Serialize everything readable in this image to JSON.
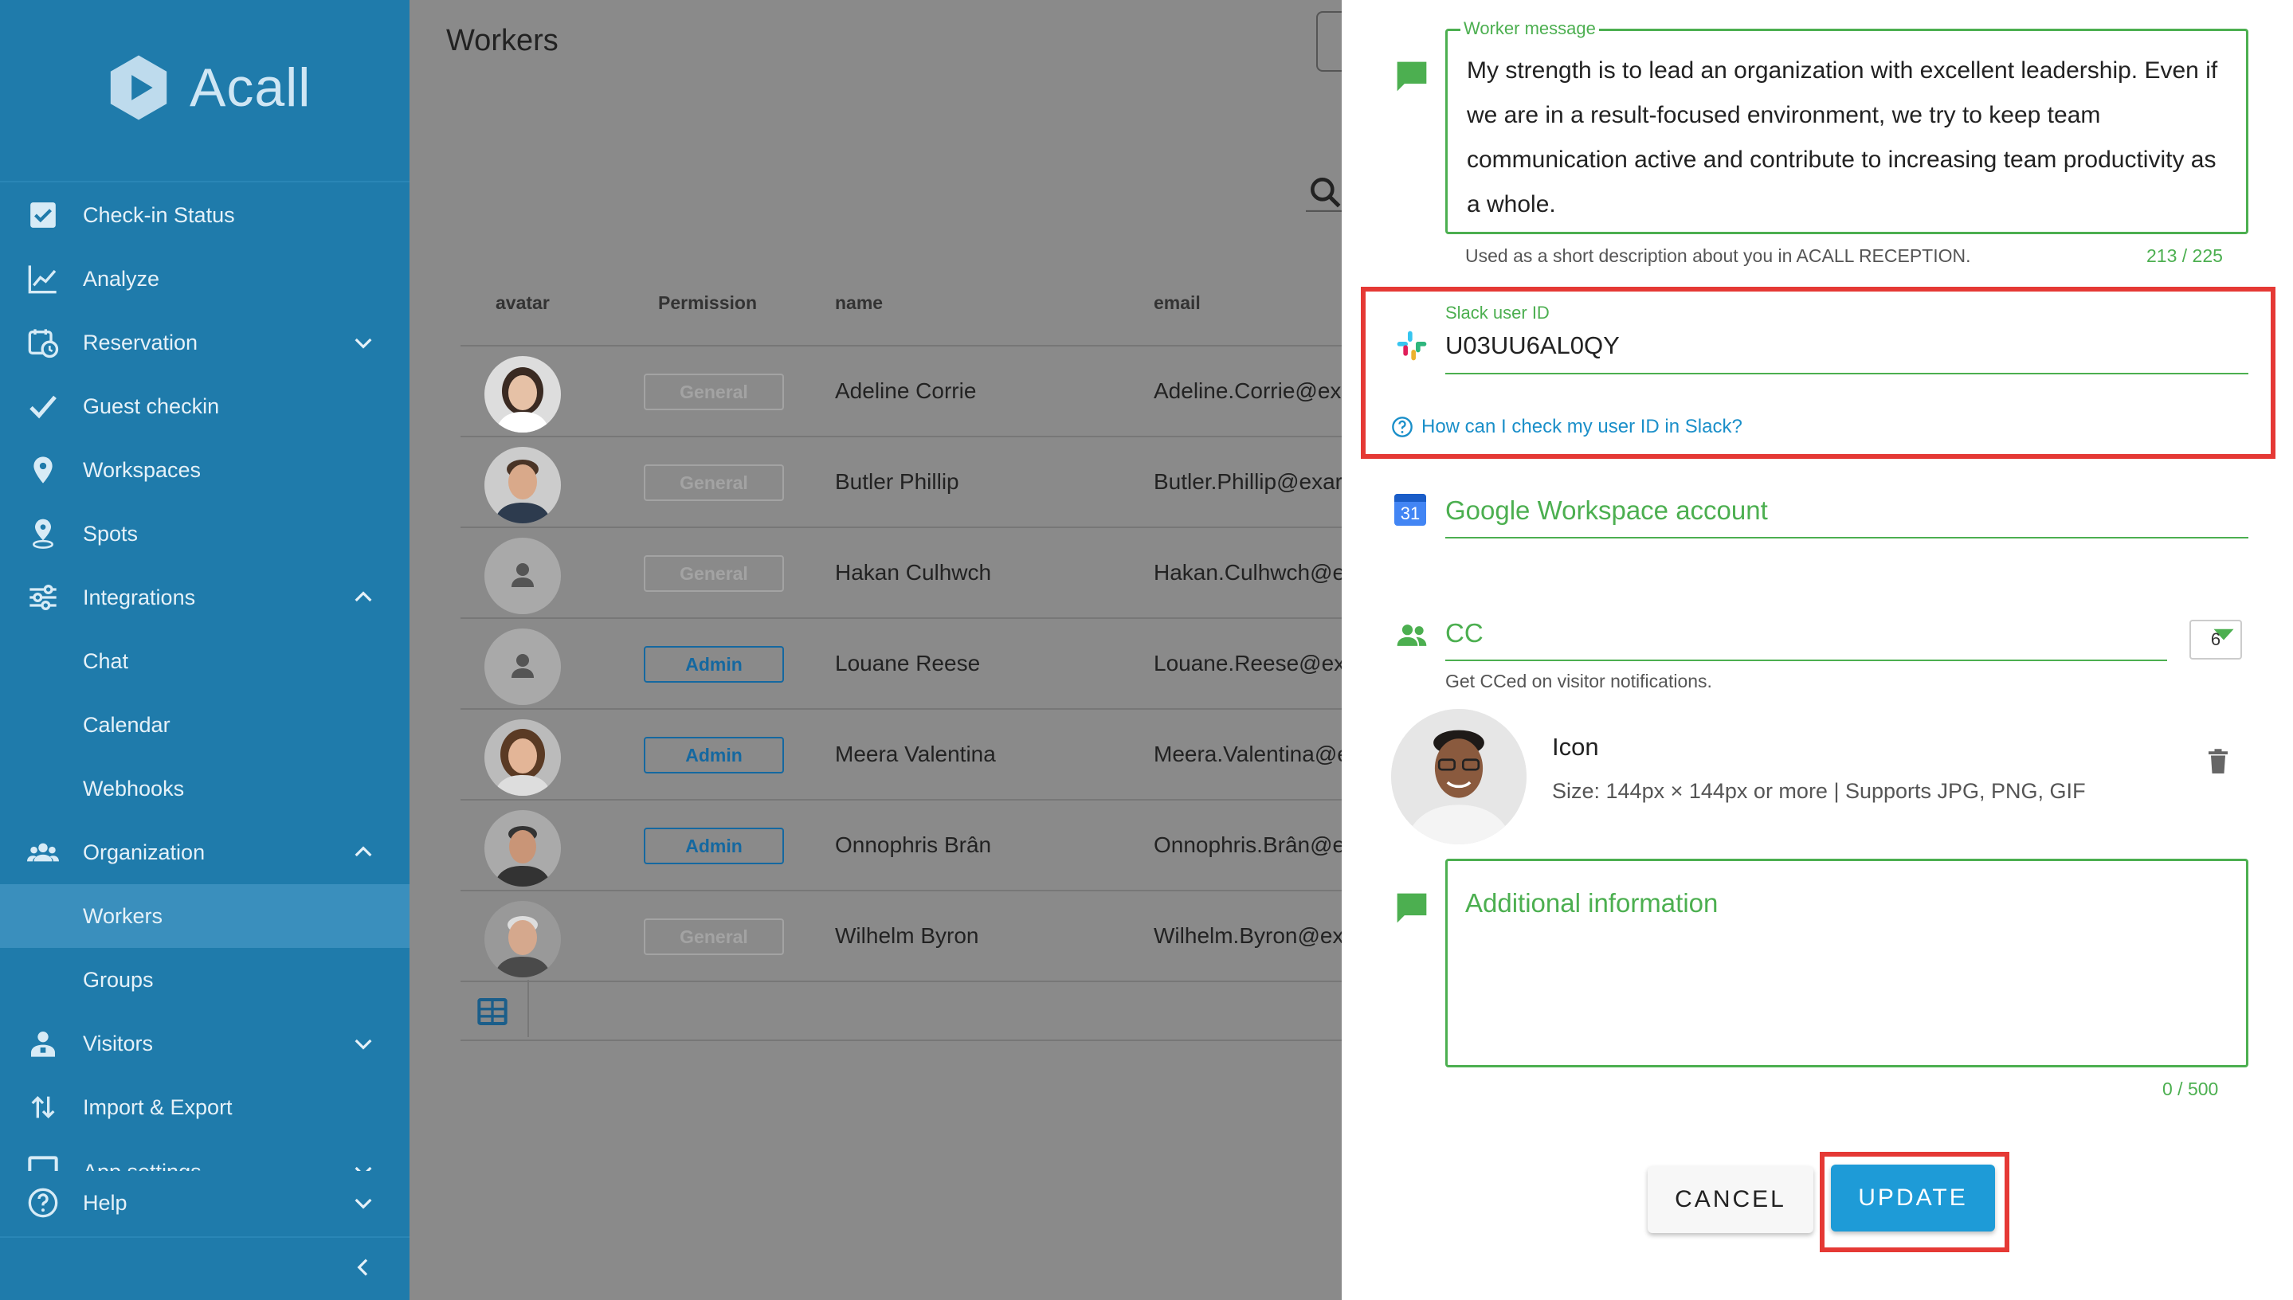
{
  "sidebar": {
    "brand": "Acall",
    "items": [
      {
        "label": "Check-in Status",
        "icon": "check-square-icon"
      },
      {
        "label": "Analyze",
        "icon": "line-chart-icon"
      },
      {
        "label": "Reservation",
        "icon": "calendar-clock-icon"
      },
      {
        "label": "Guest checkin",
        "icon": "checkmark-icon"
      },
      {
        "label": "Workspaces",
        "icon": "map-pin-icon"
      },
      {
        "label": "Spots",
        "icon": "pin-person-icon"
      },
      {
        "label": "Integrations",
        "icon": "sliders-icon"
      },
      {
        "label": "Chat"
      },
      {
        "label": "Calendar"
      },
      {
        "label": "Webhooks"
      },
      {
        "label": "Organization",
        "icon": "people-icon"
      },
      {
        "label": "Workers"
      },
      {
        "label": "Groups"
      },
      {
        "label": "Visitors",
        "icon": "visitor-icon"
      },
      {
        "label": "Import & Export",
        "icon": "import-export-icon"
      },
      {
        "label": "App settings",
        "icon": "window-icon"
      }
    ],
    "help": "Help"
  },
  "main": {
    "title": "Workers",
    "columns": [
      "avatar",
      "Permission",
      "name",
      "email"
    ],
    "rows": [
      {
        "permission": "General",
        "name": "Adeline Corrie",
        "email": "Adeline.Corrie@ex"
      },
      {
        "permission": "General",
        "name": "Butler Phillip",
        "email": "Butler.Phillip@exar"
      },
      {
        "permission": "General",
        "name": "Hakan Culhwch",
        "email": "Hakan.Culhwch@e"
      },
      {
        "permission": "Admin",
        "name": "Louane Reese",
        "email": "Louane.Reese@ex"
      },
      {
        "permission": "Admin",
        "name": "Meera Valentina",
        "email": "Meera.Valentina@e"
      },
      {
        "permission": "Admin",
        "name": "Onnophris Brân",
        "email": "Onnophris.Brân@e"
      },
      {
        "permission": "General",
        "name": "Wilhelm Byron",
        "email": "Wilhelm.Byron@ex"
      }
    ]
  },
  "drawer": {
    "worker_message": {
      "label": "Worker message",
      "value": "My strength is to lead an organization with excellent leadership. Even if we are in a result-focused environment, we try to keep team communication active and contribute to increasing team productivity as a whole.",
      "hint": "Used as a short description about you in ACALL RECEPTION.",
      "counter": "213 / 225"
    },
    "slack": {
      "label": "Slack user ID",
      "value": "U03UU6AL0QY",
      "help_link": "How can I check my user ID in Slack?"
    },
    "google": {
      "label": "Google Workspace account",
      "calendar_day": "31"
    },
    "cc": {
      "label": "CC",
      "count": "6",
      "hint": "Get CCed on visitor notifications."
    },
    "icon": {
      "title": "Icon",
      "hint": "Size: 144px × 144px or more | Supports JPG, PNG, GIF"
    },
    "additional": {
      "placeholder": "Additional information",
      "counter": "0 / 500"
    },
    "buttons": {
      "cancel": "CANCEL",
      "update": "UPDATE"
    }
  },
  "colors": {
    "sidebar": "#1f7bab",
    "accent_green": "#4caf50",
    "highlight_red": "#e53935",
    "primary_blue": "#1e9bd7"
  }
}
